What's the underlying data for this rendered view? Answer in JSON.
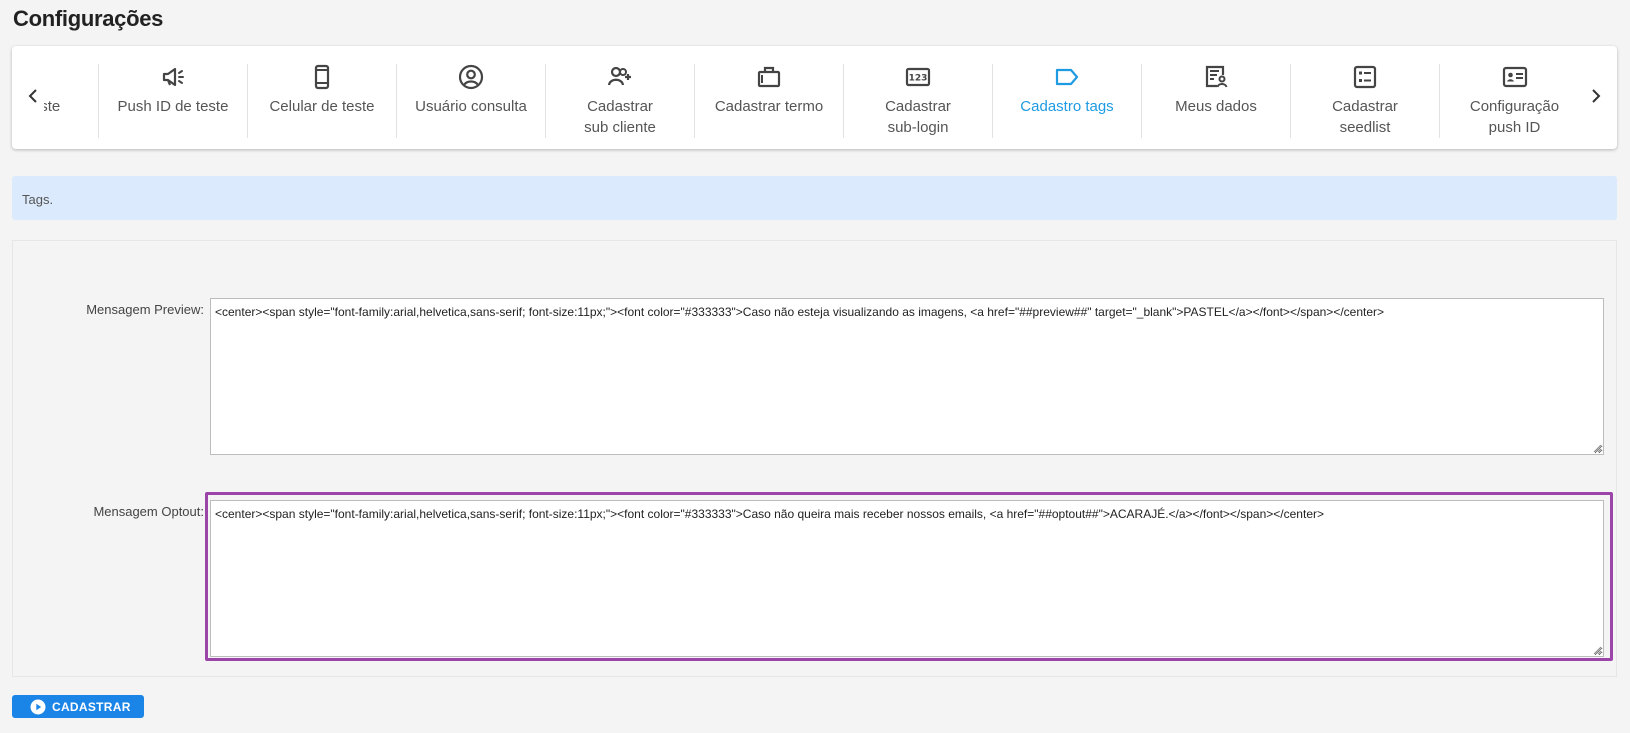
{
  "page": {
    "title": "Configurações"
  },
  "tabs": [
    {
      "label": "ail de teste",
      "icon": "send-icon",
      "active": false
    },
    {
      "label": "Push ID de teste",
      "icon": "megaphone-icon",
      "active": false
    },
    {
      "label": "Celular de teste",
      "icon": "smartphone-icon",
      "active": false
    },
    {
      "label": "Usuário consulta",
      "icon": "user-circle-icon",
      "active": false
    },
    {
      "label": "Cadastrar sub cliente",
      "icon": "user-add-icon",
      "active": false
    },
    {
      "label": "Cadastrar termo",
      "icon": "briefcase-icon",
      "active": false
    },
    {
      "label": "Cadastrar sub-login",
      "icon": "numbers-123-icon",
      "active": false
    },
    {
      "label": "Cadastro tags",
      "icon": "tag-icon",
      "active": true
    },
    {
      "label": "Meus dados",
      "icon": "profile-document-icon",
      "active": false
    },
    {
      "label": "Cadastrar seedlist",
      "icon": "checklist-icon",
      "active": false
    },
    {
      "label": "Configuração push ID",
      "icon": "id-card-icon",
      "active": false
    }
  ],
  "info": {
    "text": "Tags."
  },
  "form": {
    "preview": {
      "label": "Mensagem Preview:",
      "value": "<center><span style=\"font-family:arial,helvetica,sans-serif; font-size:11px;\"><font color=\"#333333\">Caso não esteja visualizando as imagens, <a href=\"##preview##\" target=\"_blank\">PASTEL</a></font></span></center>"
    },
    "optout": {
      "label": "Mensagem Optout:",
      "value": "<center><span style=\"font-family:arial,helvetica,sans-serif; font-size:11px;\"><font color=\"#333333\">Caso não queira mais receber nossos emails, <a href=\"##optout##\">ACARAJÉ.</a></font></span></center>"
    }
  },
  "actions": {
    "submit_label": "CADASTRAR"
  },
  "colors": {
    "accent": "#1e9be3",
    "button": "#1b84e7",
    "info_bg": "#dbeafc",
    "highlight": "#9b45a8"
  }
}
